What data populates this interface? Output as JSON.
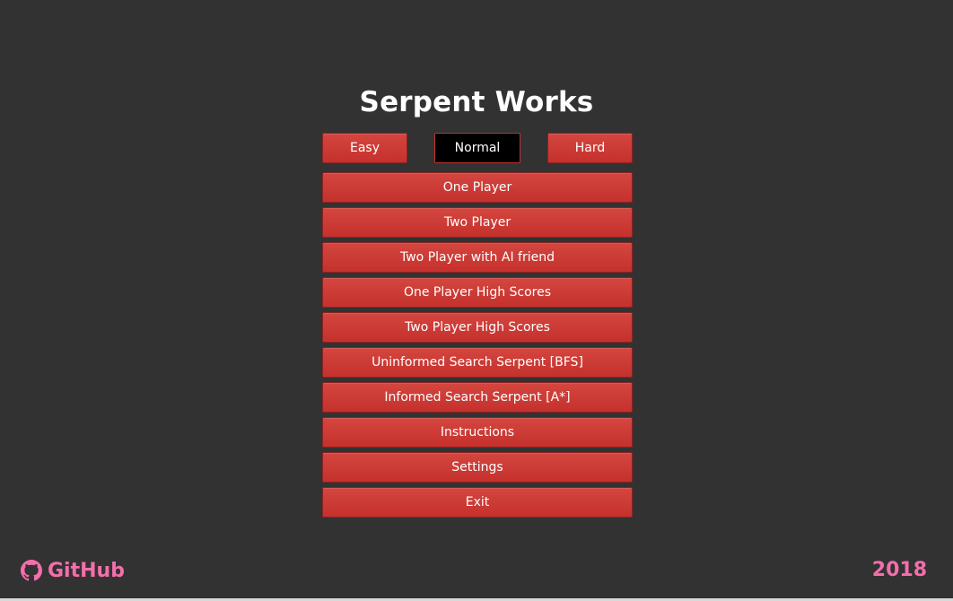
{
  "title": "Serpent Works",
  "difficulty": {
    "options": [
      "Easy",
      "Normal",
      "Hard"
    ],
    "selected": "Normal"
  },
  "menu": {
    "items": [
      "One Player",
      "Two Player",
      "Two Player with AI friend",
      "One Player High Scores",
      "Two Player High Scores",
      "Uninformed Search Serpent [BFS]",
      "Informed Search Serpent [A*]",
      "Instructions",
      "Settings",
      "Exit"
    ]
  },
  "footer": {
    "github_label": "GitHub",
    "github_icon": "github-icon",
    "year": "2018"
  },
  "colors": {
    "background": "#323232",
    "button": "#c93a35",
    "selected_button": "#000000",
    "accent": "#f36fab",
    "title": "#ffffff"
  }
}
